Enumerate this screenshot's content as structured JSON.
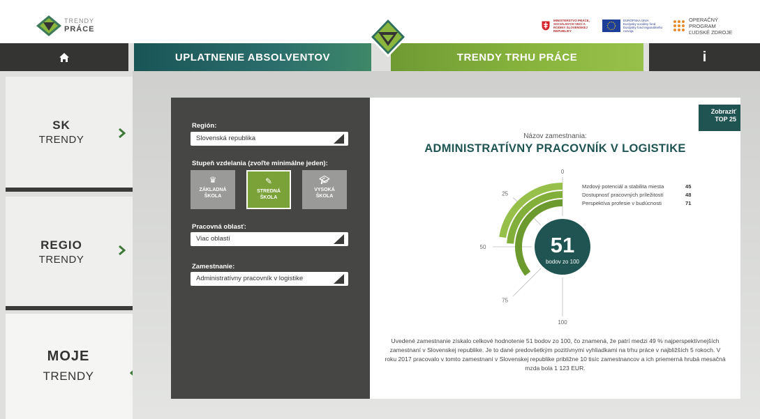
{
  "app": {
    "logo_line1": "TRENDY",
    "logo_line2": "PRÁCE"
  },
  "partners": {
    "ministry": "MINISTERSTVO PRÁCE, SOCIÁLNYCH VECÍ A RODINY SLOVENSKEJ REPUBLIKY",
    "eu_line1": "EURÓPSKA ÚNIA",
    "eu_line2": "Európsky sociálny fond Európsky fond regionálneho rozvoja",
    "op_line1": "OPERAČNÝ PROGRAM",
    "op_line2": "ĽUDSKÉ ZDROJE"
  },
  "nav": {
    "uplatnenie": "UPLATNENIE ABSOLVENTOV",
    "trendy": "TRENDY TRHU PRÁCE",
    "info": "i"
  },
  "sidebar": {
    "items": [
      {
        "title": "SK",
        "subtitle": "TRENDY"
      },
      {
        "title": "REGIO",
        "subtitle": "TRENDY"
      },
      {
        "title": "MOJE",
        "subtitle": "TRENDY"
      }
    ]
  },
  "filters": {
    "region_label": "Región:",
    "region_value": "Slovenská republika",
    "education_label": "Stupeň vzdelania (zvoľte minimálne jeden):",
    "education": [
      {
        "line1": "ZÁKLADNÁ",
        "line2": "ŠKOLA",
        "icon": "crown-icon",
        "active": false
      },
      {
        "line1": "STREDNÁ",
        "line2": "ŠKOLA",
        "icon": "wrench-icon",
        "active": true
      },
      {
        "line1": "VYSOKÁ",
        "line2": "ŠKOLA",
        "icon": "graduation-cap-icon",
        "active": false
      }
    ],
    "area_label": "Pracovná oblasť:",
    "area_value": "Viac oblastí",
    "job_label": "Zamestnanie:",
    "job_value": "Administratívny pracovník v logistike"
  },
  "result": {
    "top_button_line1": "Zobraziť",
    "top_button_line2": "TOP 25",
    "caption": "Názov zamestnania:",
    "job_title": "ADMINISTRATÍVNY PRACOVNÍK V LOGISTIKE",
    "score": "51",
    "score_caption": "bodov zo 100",
    "description": "Uvedené zamestnanie získalo celkové hodnotenie 51 bodov zo 100, čo znamená, že patrí medzi 49 % najperspektívnejších zamestnaní v Slovenskej republike. Je to dané predovšetkým pozitívnymi vyhliadkami na trhu práce v najbližších 5 rokoch. V roku 2017 pracovalo v tomto zamestnaní v Slovenskej republike približne 10 tisíc zamestnancov a ich priemerná hrubá mesačná mzda bola 1 123 EUR."
  },
  "chart_data": {
    "type": "radial-bar",
    "scale_ticks": [
      "0",
      "25",
      "50",
      "75",
      "100"
    ],
    "max": 100,
    "series": [
      {
        "name": "Mzdový potenciál a stabilita miesta",
        "value": 45,
        "value_label": "45",
        "color": "#97c04a"
      },
      {
        "name": "Dostupnosť pracovných príležitostí",
        "value": 48,
        "value_label": "48",
        "color": "#82ae3a"
      },
      {
        "name": "Perspektíva profesie v budúcnosti",
        "value": 71,
        "value_label": "71",
        "color": "#6d9a2e"
      }
    ]
  },
  "colors": {
    "dark": "#343432",
    "teal": "#1f5452",
    "green": "#8ab63e"
  }
}
